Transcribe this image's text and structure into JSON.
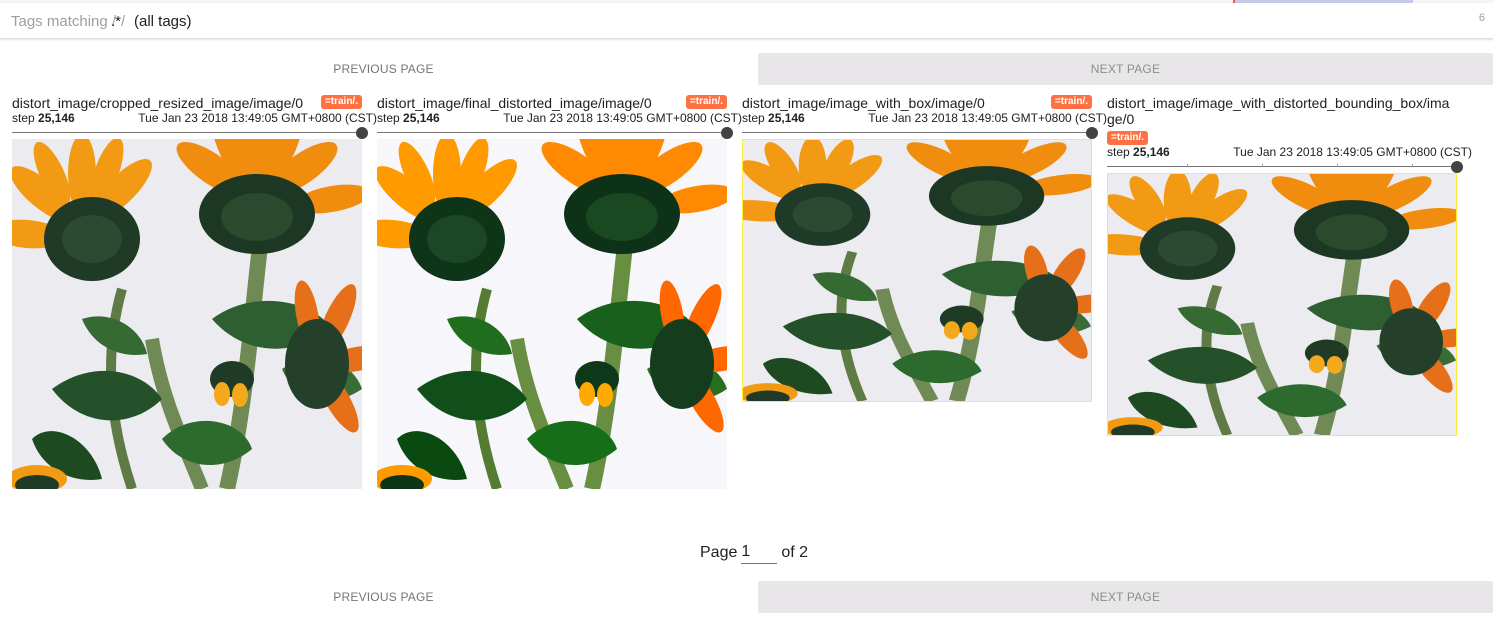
{
  "filter": {
    "prefix": "Tags matching ",
    "slash_open": "/",
    "regex": ".*",
    "slash_close": "/",
    "suffix": " (all tags)",
    "count": "6"
  },
  "pager": {
    "prev_label": "PREVIOUS PAGE",
    "next_label": "NEXT PAGE"
  },
  "pagination": {
    "page_label": "Page",
    "current_page": "1",
    "of_label": "of 2"
  },
  "colors": {
    "badge": "#ff7043",
    "box_border": "#ffeb3b",
    "next_button_bg": "#e8e6e8"
  },
  "cards": [
    {
      "title": "distort_image/cropped_resized_image/image/0",
      "run": "=train/.",
      "step_label": "step ",
      "step": "25,146",
      "time": "Tue Jan 23 2018 13:49:05 GMT+0800 (CST)",
      "image": "sunflower-cropped-resized"
    },
    {
      "title": "distort_image/final_distorted_image/image/0",
      "run": "=train/.",
      "step_label": "step ",
      "step": "25,146",
      "time": "Tue Jan 23 2018 13:49:05 GMT+0800 (CST)",
      "image": "sunflower-final-distorted"
    },
    {
      "title": "distort_image/image_with_box/image/0",
      "run": "=train/.",
      "step_label": "step ",
      "step": "25,146",
      "time": "Tue Jan 23 2018 13:49:05 GMT+0800 (CST)",
      "image": "sunflower-with-box"
    },
    {
      "title": "distort_image/image_with_distorted_bounding_box/image/0",
      "run": "=train/.",
      "step_label": "step ",
      "step": "25,146",
      "time": "Tue Jan 23 2018 13:49:05 GMT+0800 (CST)",
      "image": "sunflower-with-distorted-bounding-box"
    }
  ]
}
